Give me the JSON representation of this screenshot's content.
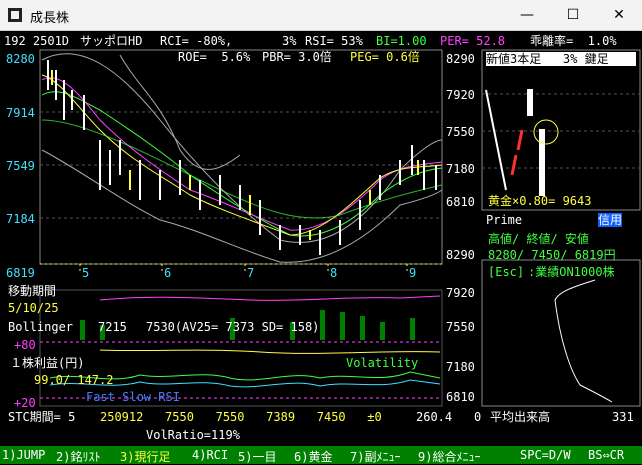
{
  "window": {
    "title": "成長株",
    "minimize": "—",
    "maximize": "☐",
    "close": "✕"
  },
  "header": {
    "code": "192 2501D",
    "name": "サッポロHD",
    "rci": "RCI= -80%,",
    "pct": "3%",
    "rsi": "RSI= 53%",
    "bi": "BI=1.00",
    "per": "PER= 52.8",
    "kairi": "乖離率=  1.0%"
  },
  "header2": {
    "roe": "ROE=  5.6%",
    "pbr": "PBR= 3.0倍",
    "peg": "PEG= 0.6倍"
  },
  "price_axis": [
    "8280",
    "7914",
    "7549",
    "7184",
    "6819"
  ],
  "months": [
    "5",
    "6",
    "7",
    "8",
    "9"
  ],
  "right_panel": {
    "title": "新値3本足   3% 鍵足",
    "axis": [
      "8290",
      "7920",
      "7550",
      "7180",
      "6810"
    ],
    "gold_line": "黄金×0.80= 9643"
  },
  "info": {
    "market": "Prime",
    "credit": "信用",
    "label": "高値/ 終値/ 安値",
    "values": "8280/ 7450/ 6819円",
    "esc_key": "[Esc]",
    "esc_text": ":業績ON1000株"
  },
  "volume_axis": [
    "8290",
    "7920",
    "7550",
    "7180",
    "6810"
  ],
  "vol_footer": {
    "zero": "0",
    "label": "平均出来高",
    "max": "331"
  },
  "indicators": {
    "ma_label": "移動期間",
    "ma_periods": "5/10/25",
    "bollinger": "Bollinger",
    "boll_vals": "7215",
    "boll_vals2": "7530(AV25= 7373 SD= 158)",
    "plus80": "+80",
    "eps": "１株利益(円)",
    "volatility": "Volatility",
    "eps_vals": "99.0/ 147.2",
    "fast_slow": "Fast Slow RSI",
    "plus20": "+20",
    "stc": "STC期間= 5",
    "stc_vals": "250912   7550   7550   7389   7450   ±0",
    "right_val": "260.4",
    "volratio": "VolRatio=119%"
  },
  "menu": [
    "1)JUMP",
    "2)銘ﾘｽﾄ",
    "3)現行足",
    "4)RCI",
    "5)一目",
    "6)黄金",
    "7)副ﾒﾆｭｰ",
    "9)総合ﾒﾆｭｰ",
    "SPC=D/W",
    "BS⇔CR"
  ],
  "colors": {
    "bg": "#000000",
    "menu": "#008000",
    "accent_yellow": "#ffff40",
    "accent_green": "#40ff40",
    "accent_cyan": "#40e0ff",
    "accent_magenta": "#ff40ff"
  }
}
